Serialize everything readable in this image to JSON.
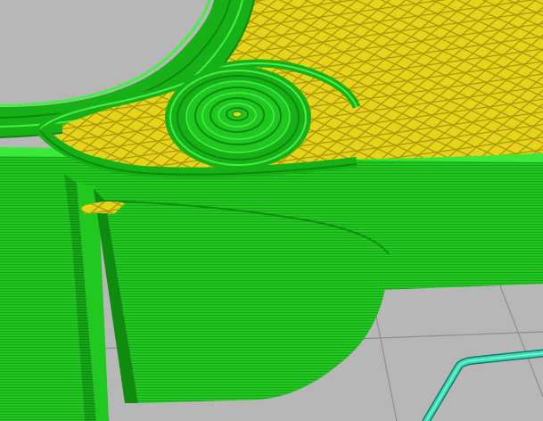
{
  "viewer": {
    "kind": "3d-print-slicer-preview",
    "legend_colors": {
      "perimeter": "#1fd41f",
      "perimeter_shadow": "#0c8f0c",
      "infill": "#e6d21a",
      "infill_line": "#a8950a",
      "travel_or_skirt": "#35e0b8",
      "build_plate": "#b7b7b7",
      "build_plate_grid": "#8c8c8c"
    },
    "infill_pattern": "triangular",
    "perimeter_layer_hatching": "horizontal"
  }
}
